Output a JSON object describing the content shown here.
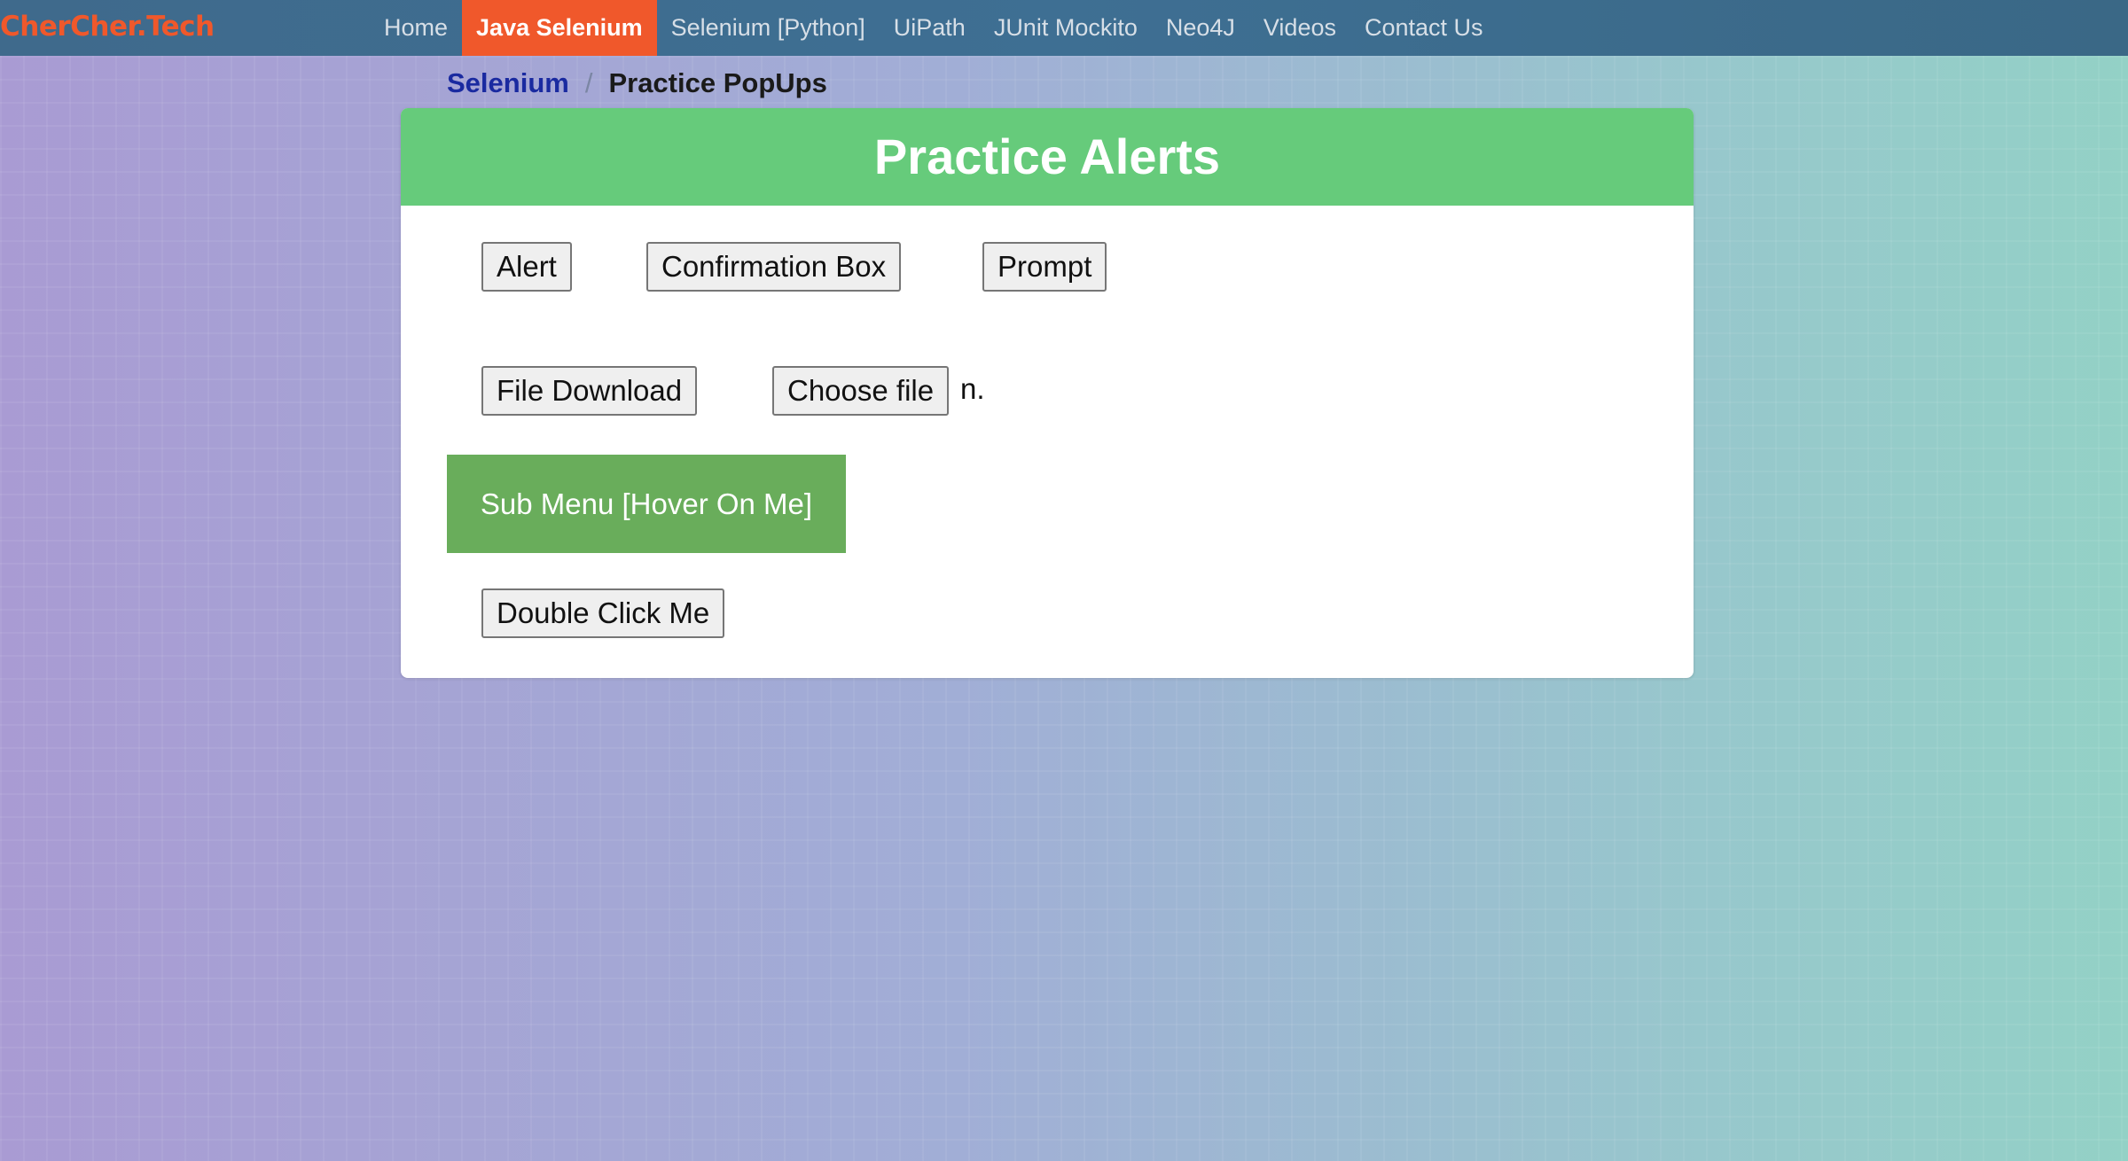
{
  "nav": {
    "brand": "CherCher.Tech",
    "items": [
      "Home",
      "Java Selenium",
      "Selenium [Python]",
      "UiPath",
      "JUnit Mockito",
      "Neo4J",
      "Videos",
      "Contact Us"
    ],
    "active": "Java Selenium"
  },
  "breadcrumb": {
    "parent": "Selenium",
    "separator": "/",
    "current": "Practice PopUps"
  },
  "card": {
    "title": "Practice Alerts",
    "alert_label": "Alert",
    "confirm_label": "Confirmation Box",
    "prompt_label": "Prompt",
    "download_label": "File Download",
    "choose_file_label": "Choose file",
    "file_status": "n.",
    "submenu_label": "Sub Menu [Hover On Me]",
    "double_click_label": "Double Click Me"
  },
  "colors": {
    "brand": "#f0582b",
    "header_green": "#66cb7b",
    "submenu_green": "#69ad5b"
  }
}
